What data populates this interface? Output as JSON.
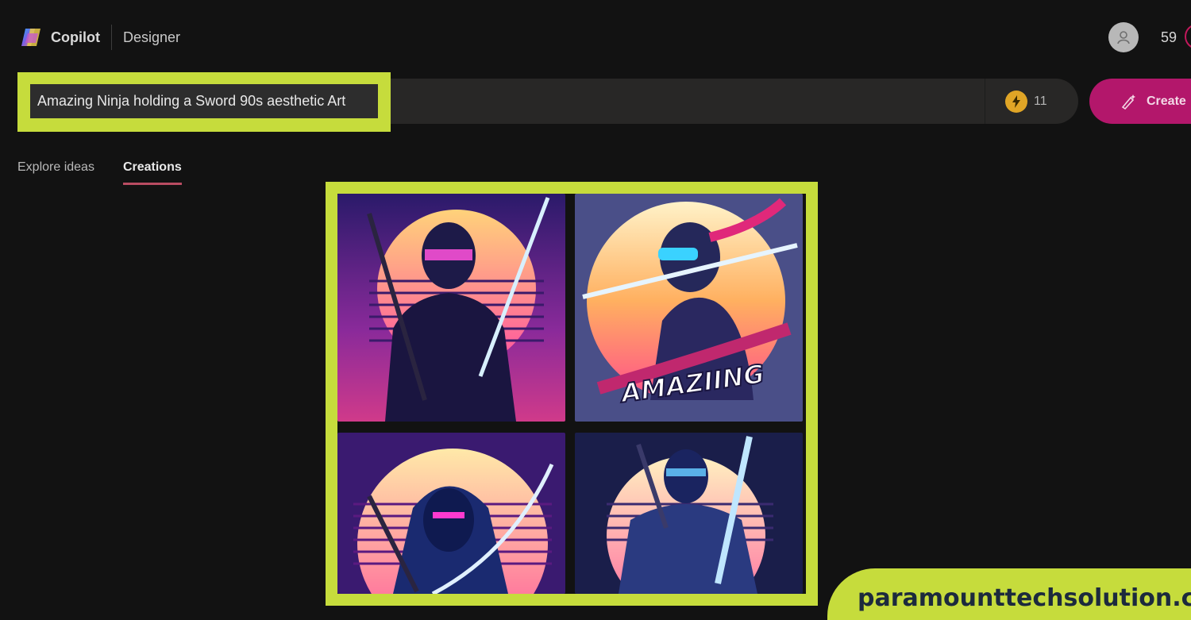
{
  "header": {
    "brand": "Copilot",
    "product": "Designer",
    "boost_count": "59"
  },
  "prompt": {
    "value": "Amazing Ninja holding a Sword 90s aesthetic Art",
    "boosts_left": "11",
    "create_label": "Create"
  },
  "tabs": [
    {
      "label": "Explore ideas",
      "active": false
    },
    {
      "label": "Creations",
      "active": true
    }
  ],
  "gallery": {
    "images": [
      {
        "icon": "ninja-image-1"
      },
      {
        "icon": "ninja-image-2",
        "overlay_text": "AMAZIING"
      },
      {
        "icon": "ninja-image-3"
      },
      {
        "icon": "ninja-image-4"
      }
    ]
  },
  "watermark": "paramounttechsolution.com",
  "colors": {
    "highlight": "#c6dc3c",
    "create_button": "#b3176b",
    "tab_underline": "#b94c62",
    "background": "#121212"
  }
}
